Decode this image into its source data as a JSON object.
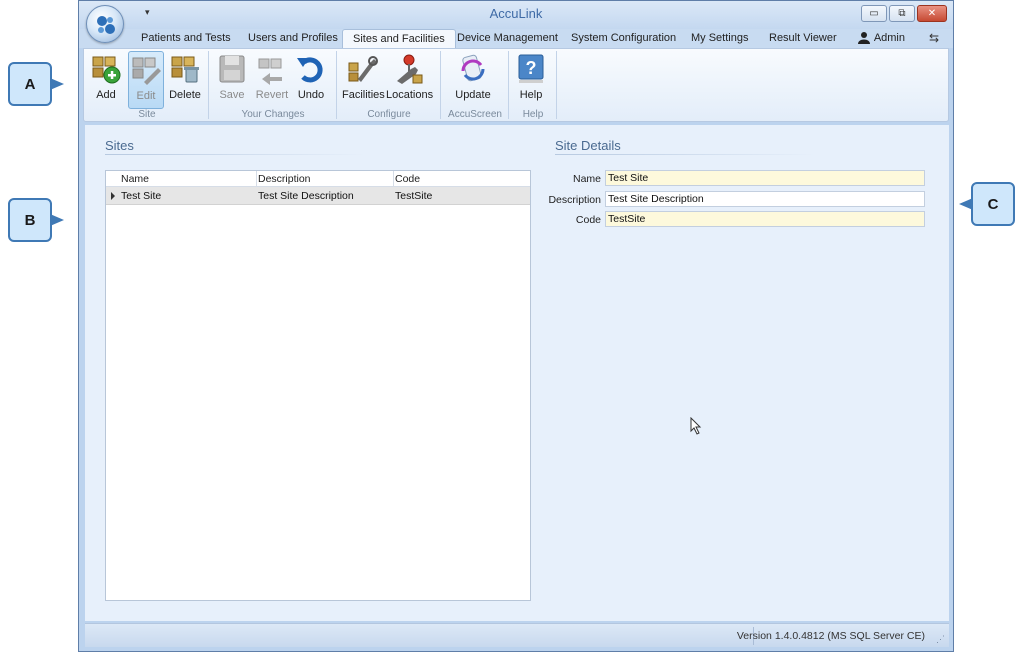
{
  "callouts": {
    "a": "A",
    "b": "B",
    "c": "C"
  },
  "window": {
    "title": "AccuLink",
    "qat_glyph": "▾",
    "controls": {
      "minimize": "▭",
      "maximize": "⧉",
      "close": "✕"
    }
  },
  "tabs": [
    {
      "label": "Patients and Tests"
    },
    {
      "label": "Users and Profiles"
    },
    {
      "label": "Sites and Facilities",
      "active": true
    },
    {
      "label": "Device Management"
    },
    {
      "label": "System Configuration"
    },
    {
      "label": "My Settings"
    },
    {
      "label": "Result Viewer"
    }
  ],
  "user": {
    "name": "Admin",
    "icon": "user-icon"
  },
  "ribbon": {
    "buttons": {
      "add": {
        "label": "Add",
        "icon": "add-icon"
      },
      "edit": {
        "label": "Edit",
        "icon": "edit-icon",
        "state": "pressed-disabled"
      },
      "delete": {
        "label": "Delete",
        "icon": "delete-icon"
      },
      "save": {
        "label": "Save",
        "icon": "save-icon",
        "state": "disabled"
      },
      "revert": {
        "label": "Revert",
        "icon": "revert-icon",
        "state": "disabled"
      },
      "undo": {
        "label": "Undo",
        "icon": "undo-icon"
      },
      "facilities": {
        "label": "Facilities",
        "icon": "facilities-icon"
      },
      "locations": {
        "label": "Locations",
        "icon": "locations-icon"
      },
      "update": {
        "label": "Update",
        "icon": "update-icon"
      },
      "help": {
        "label": "Help",
        "icon": "help-icon"
      }
    },
    "groups": {
      "site": "Site",
      "changes": "Your Changes",
      "configure": "Configure",
      "accuscreen": "AccuScreen",
      "help": "Help"
    }
  },
  "sites": {
    "title": "Sites",
    "columns": [
      "Name",
      "Description",
      "Code"
    ],
    "rows": [
      {
        "name": "Test Site",
        "description": "Test Site Description",
        "code": "TestSite"
      }
    ]
  },
  "details": {
    "title": "Site Details",
    "name_label": "Name",
    "name_value": "Test Site",
    "description_label": "Description",
    "description_value": "Test Site Description",
    "code_label": "Code",
    "code_value": "TestSite"
  },
  "status": {
    "version": "Version 1.4.0.4812 (MS SQL Server CE)"
  },
  "colors": {
    "accent": "#3f79b5",
    "background": "#e7f0fb",
    "required_field": "#fdf9dc",
    "close": "#c64a33"
  }
}
